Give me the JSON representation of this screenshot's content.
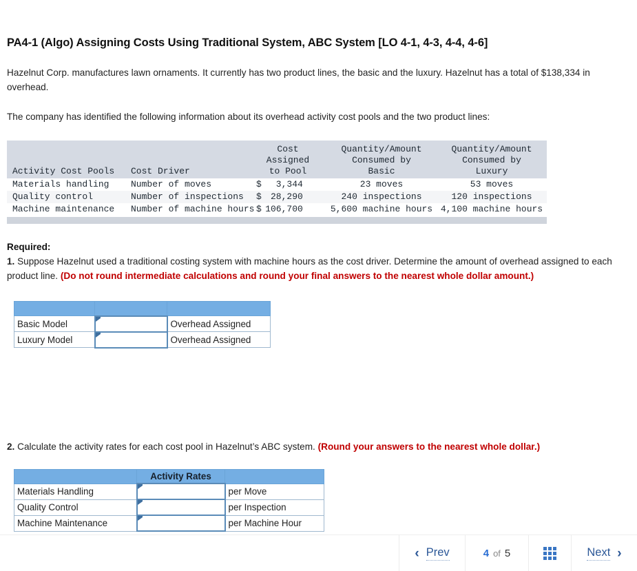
{
  "question": {
    "title": "PA4-1 (Algo) Assigning Costs Using Traditional System, ABC System [LO 4-1, 4-3, 4-4, 4-6]",
    "intro": "Hazelnut Corp. manufactures lawn ornaments. It currently has two product lines, the basic and the luxury. Hazelnut has a total of $138,334 in overhead.",
    "lead_in": "The company has identified the following information about its overhead activity cost pools and the two product lines:"
  },
  "info_table": {
    "headers": [
      "Activity Cost Pools",
      "Cost Driver",
      "Cost\nAssigned\nto Pool",
      "Quantity/Amount\nConsumed by\nBasic",
      "Quantity/Amount\nConsumed by\nLuxury"
    ],
    "rows": [
      {
        "pool": "Materials handling",
        "driver": "Number of moves",
        "cost_symbol": "$",
        "cost": "3,344",
        "basic": "23 moves",
        "luxury": "53 moves"
      },
      {
        "pool": "Quality control",
        "driver": "Number of inspections",
        "cost_symbol": "$",
        "cost": "28,290",
        "basic": "240 inspections",
        "luxury": "120 inspections"
      },
      {
        "pool": "Machine maintenance",
        "driver": "Number of machine hours",
        "cost_symbol": "$",
        "cost": "106,700",
        "basic": "5,600 machine hours",
        "luxury": "4,100 machine hours"
      }
    ]
  },
  "required": {
    "heading": "Required:",
    "q1_num": "1.",
    "q1_text": " Suppose Hazelnut used a traditional costing system with machine hours as the cost driver. Determine the amount of overhead assigned to each product line. ",
    "q1_note": "(Do not round intermediate calculations and round your final answers to the nearest whole dollar amount.)",
    "q2_num": "2.",
    "q2_text": " Calculate the activity rates for each cost pool in Hazelnut’s ABC system. ",
    "q2_note": "(Round your answers to the nearest whole dollar.)"
  },
  "answer_table_1": {
    "header_cells": [
      "",
      "",
      ""
    ],
    "rows": [
      {
        "label": "Basic Model",
        "value": "",
        "unit": "Overhead Assigned"
      },
      {
        "label": "Luxury Model",
        "value": "",
        "unit": "Overhead Assigned"
      }
    ]
  },
  "answer_table_2": {
    "header_cells": [
      "",
      "Activity Rates",
      ""
    ],
    "rows": [
      {
        "label": "Materials Handling",
        "value": "",
        "unit": "per Move"
      },
      {
        "label": "Quality Control",
        "value": "",
        "unit": "per Inspection"
      },
      {
        "label": "Machine Maintenance",
        "value": "",
        "unit": "per Machine Hour"
      }
    ]
  },
  "footer_nav": {
    "prev_label": "Prev",
    "next_label": "Next",
    "prev_icon": "chevron-left-icon",
    "next_icon": "chevron-right-icon",
    "current_page": "4",
    "of_label": "of",
    "total_pages": "5",
    "grid_icon": "grid-view-icon"
  },
  "colors": {
    "header_blue": "#74aee3",
    "mono_header_grey": "#d5dae3",
    "accent_link": "#2b5797",
    "note_red": "#c00000",
    "input_border": "#5a8bb8"
  }
}
